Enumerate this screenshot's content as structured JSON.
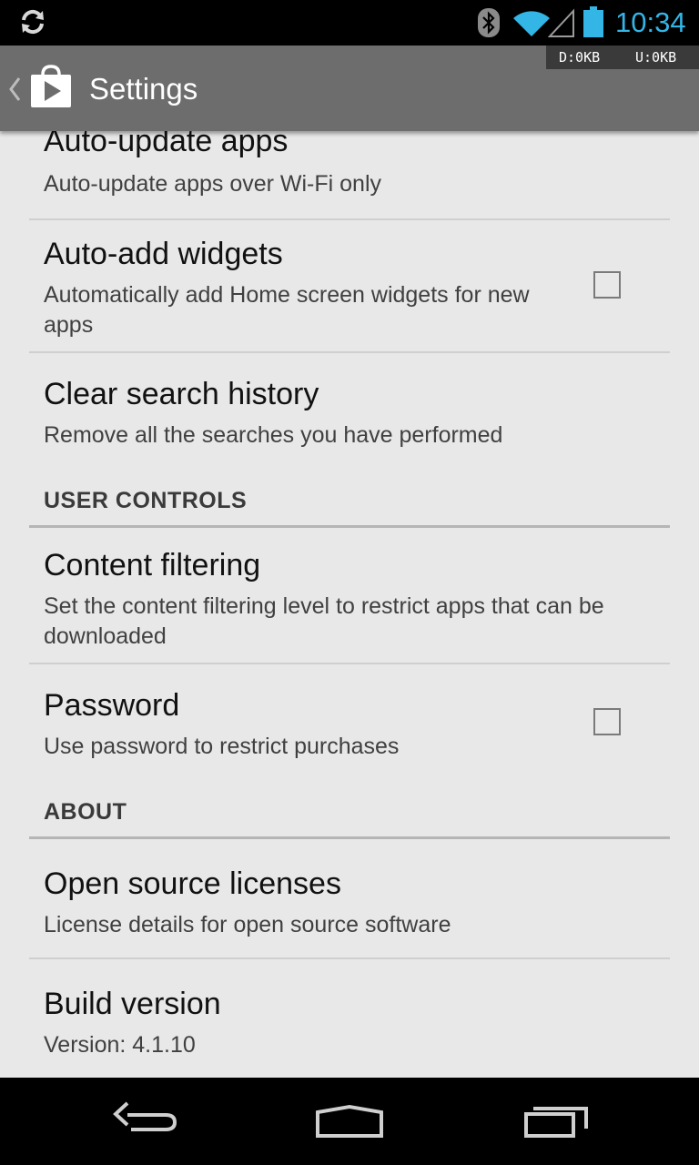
{
  "status_bar": {
    "time": "10:34",
    "icons": [
      "sync-icon",
      "bluetooth-icon",
      "wifi-icon",
      "cell-signal-icon",
      "battery-icon"
    ],
    "clock_color": "#33b5e5"
  },
  "action_bar": {
    "title": "Settings",
    "app_icon": "play-store-icon",
    "data_usage": {
      "download": "D:0KB",
      "upload": "U:0KB"
    }
  },
  "settings": {
    "auto_update": {
      "title": "Auto-update apps",
      "summary": "Auto-update apps over Wi-Fi only"
    },
    "auto_add_widgets": {
      "title": "Auto-add widgets",
      "summary": "Automatically add Home screen widgets for new apps",
      "checked": false
    },
    "clear_search_history": {
      "title": "Clear search history",
      "summary": "Remove all the searches you have performed"
    },
    "user_controls_header": "USER CONTROLS",
    "content_filtering": {
      "title": "Content filtering",
      "summary": "Set the content filtering level to restrict apps that can be downloaded"
    },
    "password": {
      "title": "Password",
      "summary": "Use password to restrict purchases",
      "checked": false
    },
    "about_header": "ABOUT",
    "open_source_licenses": {
      "title": "Open source licenses",
      "summary": "License details for open source software"
    },
    "build_version": {
      "title": "Build version",
      "summary": "Version: 4.1.10"
    }
  },
  "nav_bar": {
    "buttons": [
      "back-icon",
      "home-icon",
      "recents-icon"
    ]
  }
}
